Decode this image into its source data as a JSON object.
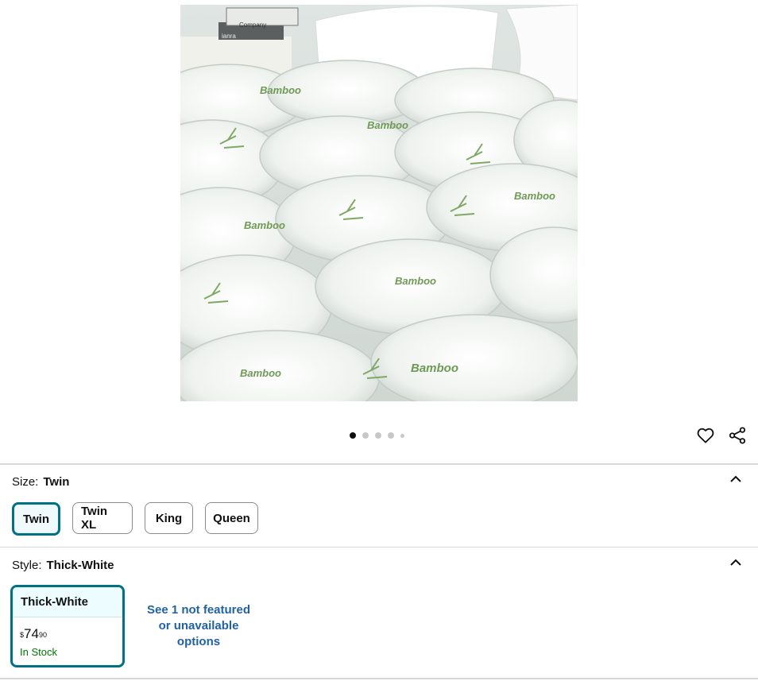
{
  "product_image": {
    "pillow_label": "Company",
    "book_label": "ianra",
    "pattern_text": "Bamboo"
  },
  "carousel": {
    "dots": 5,
    "active_index": 0
  },
  "actions": {
    "wishlist_icon": "heart-icon",
    "share_icon": "share-icon"
  },
  "size": {
    "label": "Size:",
    "selected": "Twin",
    "options": [
      "Twin",
      "Twin XL",
      "King",
      "Queen"
    ]
  },
  "style": {
    "label": "Style:",
    "selected": "Thick-White",
    "card": {
      "name": "Thick-White",
      "currency": "$",
      "price_whole": "74",
      "price_fraction": "90",
      "availability": "In Stock"
    },
    "see_more_lines": [
      "See 1 not featured",
      "or unavailable",
      "options"
    ]
  },
  "colors": {
    "accent": "#007185",
    "link": "#2162a1",
    "in_stock": "#007600",
    "divider": "#d5d9d9",
    "pattern_green": "#6f9a55"
  }
}
